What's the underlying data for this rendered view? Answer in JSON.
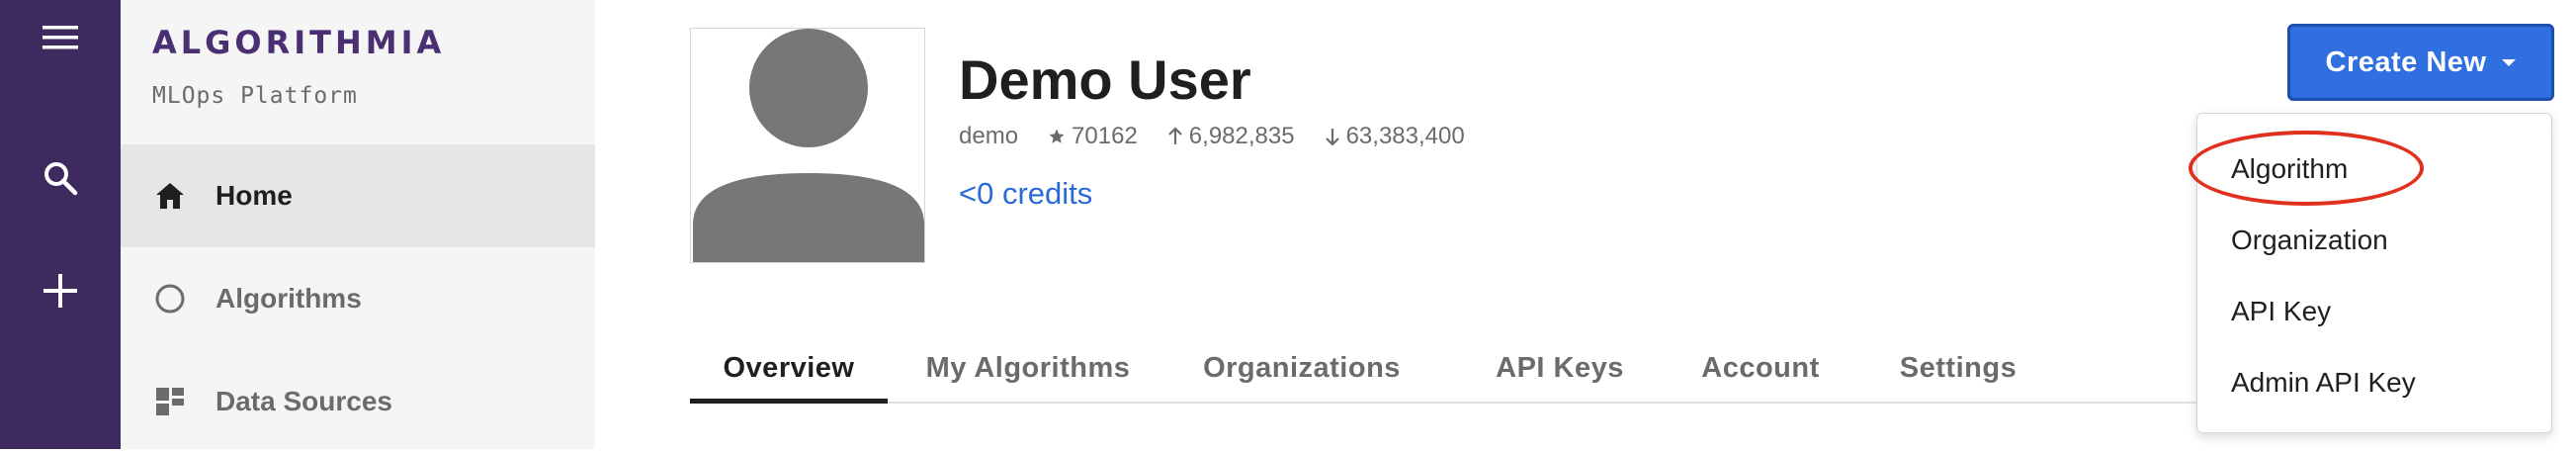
{
  "rail": {
    "icons": [
      "menu-icon",
      "search-icon",
      "plus-icon"
    ],
    "bg_color": "#3d2a5e"
  },
  "sidebar": {
    "brand": "ALGORITHMIA",
    "subtitle": "MLOps Platform",
    "items": [
      {
        "label": "Home",
        "icon": "home-icon",
        "active": true
      },
      {
        "label": "Algorithms",
        "icon": "circle-icon",
        "active": false
      },
      {
        "label": "Data Sources",
        "icon": "grid-icon",
        "active": false
      }
    ]
  },
  "profile": {
    "name": "Demo User",
    "username": "demo",
    "stars": "70162",
    "uploaded": "6,982,835",
    "downloaded": "63,383,400",
    "credits": "<0 credits"
  },
  "tabs": [
    {
      "label": "Overview",
      "active": true
    },
    {
      "label": "My Algorithms",
      "active": false
    },
    {
      "label": "Organizations",
      "active": false
    },
    {
      "label": "API Keys",
      "active": false
    },
    {
      "label": "Account",
      "active": false
    },
    {
      "label": "Settings",
      "active": false
    }
  ],
  "create_button": {
    "label": "Create New",
    "color": "#2f6fe0"
  },
  "create_menu": {
    "items": [
      "Algorithm",
      "Organization",
      "API Key",
      "Admin API Key"
    ],
    "highlighted": "Algorithm",
    "highlight_color": "#e0301e"
  },
  "accent_colors": {
    "brand": "#4a2f73",
    "link": "#2a6ad6"
  }
}
